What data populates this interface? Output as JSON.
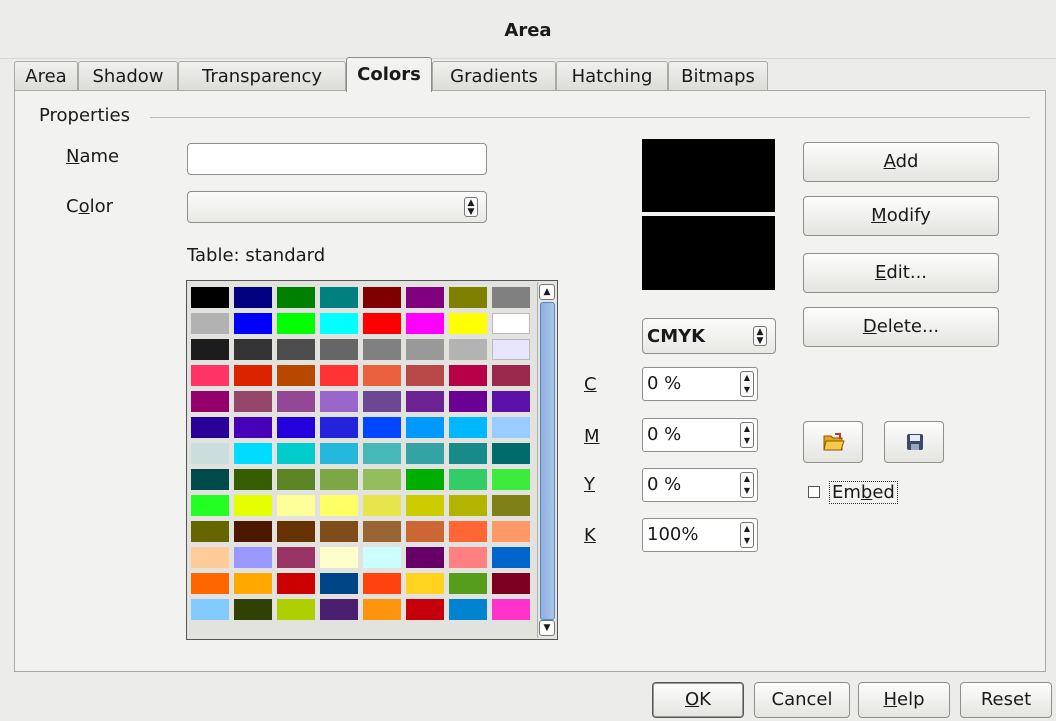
{
  "window": {
    "title": "Area"
  },
  "tabs": [
    {
      "label": "Area"
    },
    {
      "label": "Shadow"
    },
    {
      "label": "Transparency"
    },
    {
      "label": "Colors",
      "active": true
    },
    {
      "label": "Gradients"
    },
    {
      "label": "Hatching"
    },
    {
      "label": "Bitmaps"
    }
  ],
  "properties": {
    "legend": "Properties",
    "name_label_mnemonic": "N",
    "name_label_rest": "ame",
    "name_value": "",
    "color_label_pre": "C",
    "color_label_mnemonic": "o",
    "color_label_rest": "lor",
    "color_value": "",
    "table_label": "Table: standard"
  },
  "palette_colors": [
    [
      "#000000",
      "#000080",
      "#008000",
      "#008080",
      "#800000",
      "#800080",
      "#808000",
      "#808080"
    ],
    [
      "#b2b2b2",
      "#0000ff",
      "#00ff00",
      "#00ffff",
      "#ff0000",
      "#ff00ff",
      "#ffff00",
      "#ffffff"
    ],
    [
      "#1c1c1c",
      "#333333",
      "#4d4d4d",
      "#666666",
      "#808080",
      "#999999",
      "#b3b3b3",
      "#e6e6ff"
    ],
    [
      "#ff3366",
      "#dc2300",
      "#b84700",
      "#ff3333",
      "#eb613d",
      "#b84747",
      "#b80047",
      "#99284c"
    ],
    [
      "#94006b",
      "#94476b",
      "#944794",
      "#9966cc",
      "#6b4794",
      "#6b2394",
      "#6b0094",
      "#5e11a6"
    ],
    [
      "#280099",
      "#4700b8",
      "#2300dc",
      "#2323dc",
      "#0047ff",
      "#0099ff",
      "#00b8ff",
      "#99ccff"
    ],
    [
      "#ccdddd",
      "#00dcff",
      "#00cccc",
      "#23b8dc",
      "#47b8b8",
      "#33a3a3",
      "#198a8a",
      "#006b6b"
    ],
    [
      "#004a4a",
      "#355e00",
      "#5c8526",
      "#7da647",
      "#94bd5e",
      "#00ae00",
      "#33cc66",
      "#3deb3d"
    ],
    [
      "#23ff23",
      "#e6ff00",
      "#ffff99",
      "#ffff66",
      "#e6e64c",
      "#cccc00",
      "#b3b300",
      "#808019"
    ],
    [
      "#666600",
      "#4c1900",
      "#663300",
      "#804c19",
      "#996633",
      "#cc6633",
      "#ff6633",
      "#ff9966"
    ],
    [
      "#ffcc99",
      "#9999ff",
      "#993366",
      "#ffffcc",
      "#ccffff",
      "#660066",
      "#ff8080",
      "#0066cc"
    ],
    [
      "#ff6600",
      "#ffa900",
      "#cc0000",
      "#004586",
      "#ff420e",
      "#ffd320",
      "#579d1c",
      "#7e0021"
    ],
    [
      "#83caff",
      "#314004",
      "#aecf00",
      "#4b1f6f",
      "#ff950e",
      "#c5000b",
      "#0084d1",
      "#ff33cc"
    ]
  ],
  "preview": {
    "old_color": "#000000",
    "new_color": "#000000"
  },
  "color_model": {
    "value": "CMYK"
  },
  "channels": [
    {
      "label": "C",
      "value": "0 %"
    },
    {
      "label": "M",
      "value": "0 %"
    },
    {
      "label": "Y",
      "value": "0 %"
    },
    {
      "label": "K",
      "value": "100%"
    }
  ],
  "buttons": {
    "add_mn": "A",
    "add_rest": "dd",
    "modify_mn": "M",
    "modify_rest": "odify",
    "edit_mn": "E",
    "edit_rest": "dit...",
    "delete_mn": "D",
    "delete_rest": "elete..."
  },
  "icons": {
    "load": "open-folder-icon",
    "save": "floppy-disk-icon"
  },
  "embed": {
    "pre": "Em",
    "mn": "b",
    "rest": "ed",
    "checked": false
  },
  "footer": {
    "ok_mn": "O",
    "ok_rest": "K",
    "cancel": "Cancel",
    "help_mn": "H",
    "help_rest": "elp",
    "reset": "Reset"
  }
}
